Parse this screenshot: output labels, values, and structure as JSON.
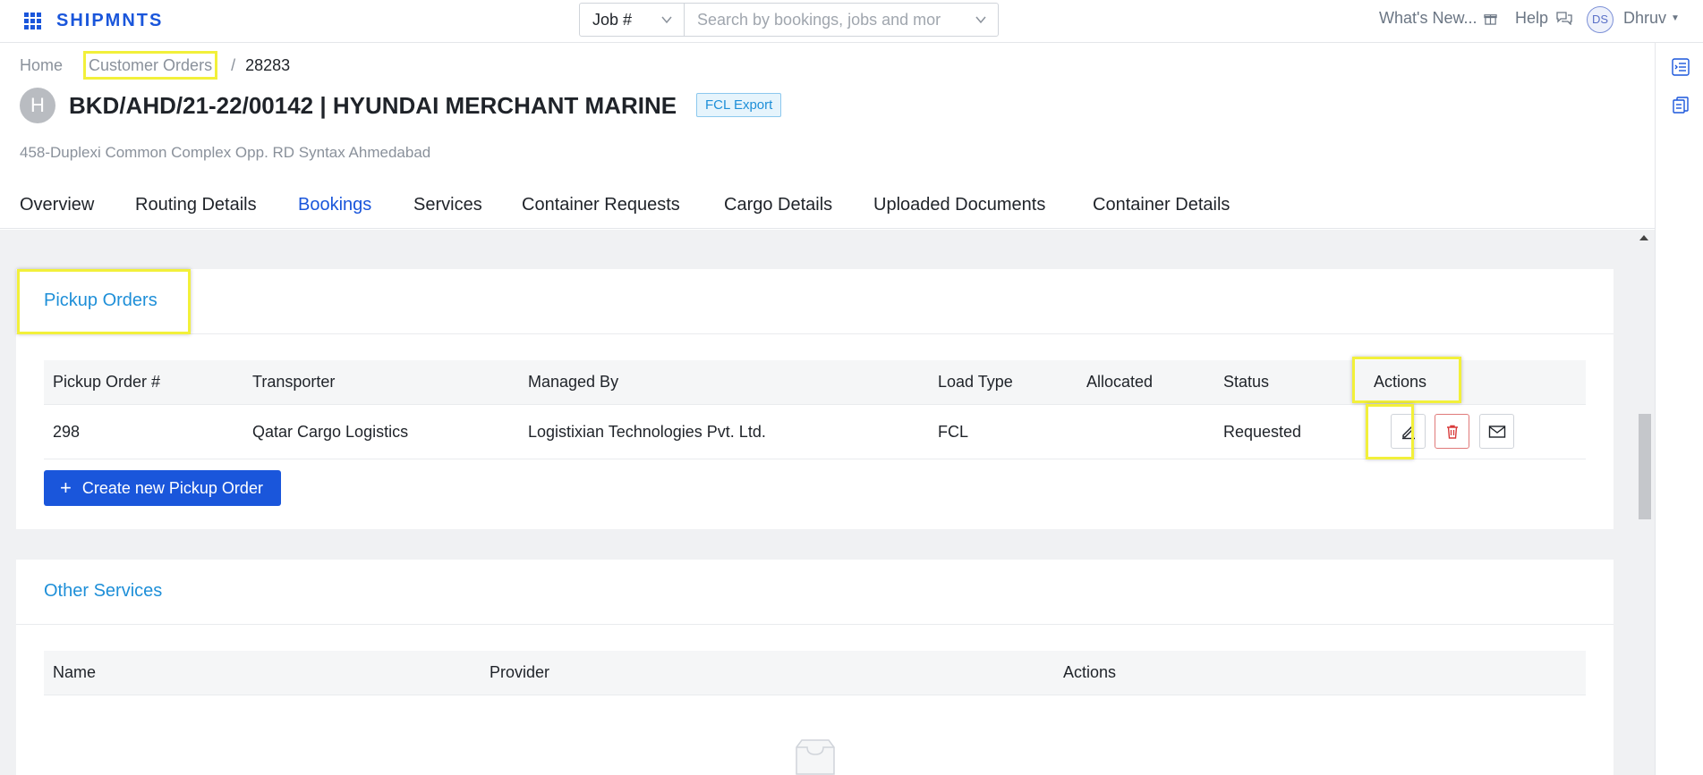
{
  "app": {
    "brand": "SHIPMNTS"
  },
  "topbar": {
    "job_select": "Job #",
    "search_placeholder": "Search by bookings, jobs and mor...",
    "whats_new": "What's New...",
    "help": "Help",
    "avatar_initials": "DS",
    "username": "Dhruv"
  },
  "breadcrumb": {
    "home": "Home",
    "section": "Customer Orders",
    "separator": "/",
    "current": "28283"
  },
  "header": {
    "avatar_letter": "H",
    "title": "BKD/AHD/21-22/00142 | HYUNDAI MERCHANT MARINE",
    "tag": "FCL Export",
    "address": "458-Duplexi Common Complex Opp. RD Syntax Ahmedabad"
  },
  "tabs": [
    "Overview",
    "Routing Details",
    "Bookings",
    "Services",
    "Container Requests",
    "Cargo Details",
    "Uploaded Documents",
    "Container Details"
  ],
  "active_tab": "Bookings",
  "pickup_orders": {
    "title": "Pickup Orders",
    "columns": [
      "Pickup Order #",
      "Transporter",
      "Managed By",
      "Load Type",
      "Allocated",
      "Status",
      "Actions"
    ],
    "rows": [
      {
        "number": "298",
        "transporter": "Qatar Cargo Logistics",
        "managed_by": "Logistixian Technologies Pvt. Ltd.",
        "load_type": "FCL",
        "allocated": "",
        "status": "Requested"
      }
    ],
    "create_button": "Create new Pickup Order"
  },
  "other_services": {
    "title": "Other Services",
    "columns": [
      "Name",
      "Provider",
      "Actions"
    ]
  },
  "colors": {
    "primary": "#1a56db",
    "link": "#1e8fd8",
    "highlight": "#f2f03a",
    "danger": "#d83a3a"
  }
}
